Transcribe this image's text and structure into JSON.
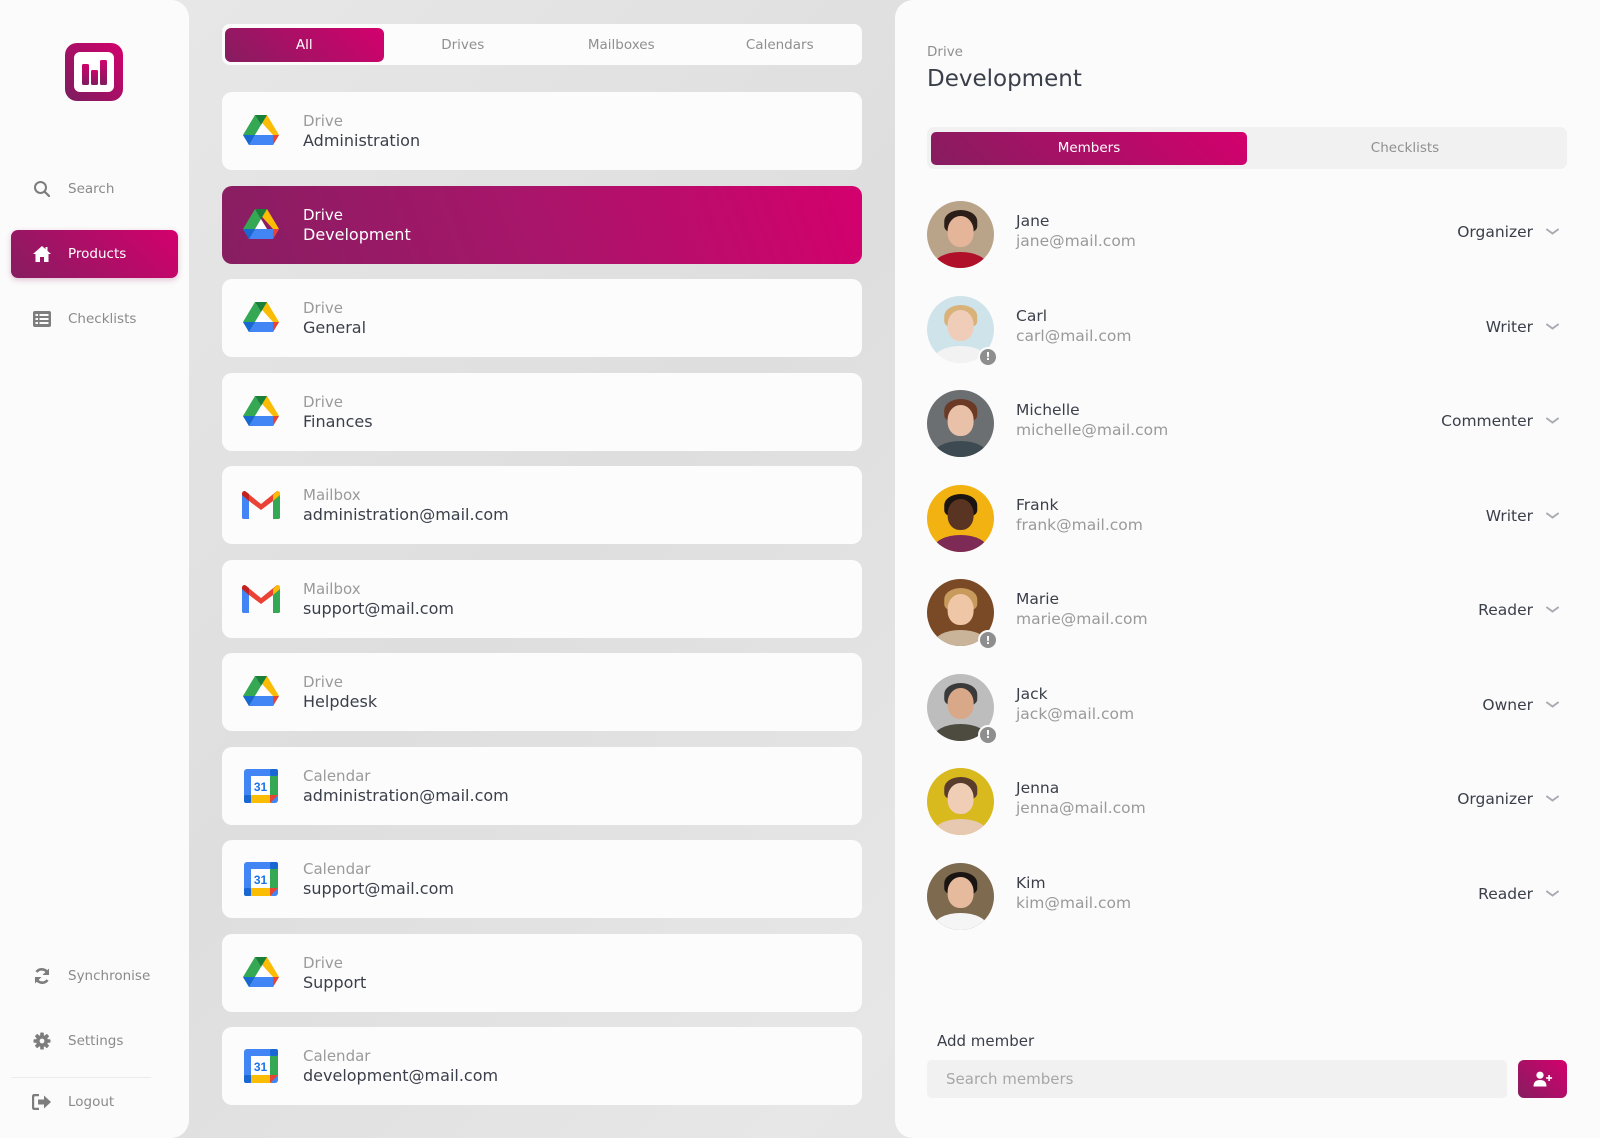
{
  "colors": {
    "accent_start": "#d4006d",
    "accent_end": "#861d60",
    "muted_text": "#8f8f8f",
    "primary_text": "#3a3f4a"
  },
  "sidebar": {
    "logo_icon": "bar-chart-logo",
    "items": [
      {
        "label": "Search",
        "icon": "search-icon",
        "active": false
      },
      {
        "label": "Products",
        "icon": "home-icon",
        "active": true
      },
      {
        "label": "Checklists",
        "icon": "list-icon",
        "active": false
      }
    ],
    "bottom_items": [
      {
        "label": "Synchronise",
        "icon": "sync-icon"
      },
      {
        "label": "Settings",
        "icon": "gear-icon"
      },
      {
        "label": "Logout",
        "icon": "logout-icon"
      }
    ]
  },
  "filter_tabs": [
    {
      "label": "All",
      "active": true
    },
    {
      "label": "Drives",
      "active": false
    },
    {
      "label": "Mailboxes",
      "active": false
    },
    {
      "label": "Calendars",
      "active": false
    }
  ],
  "resources": [
    {
      "type": "Drive",
      "name": "Administration",
      "icon": "google-drive-icon",
      "active": false
    },
    {
      "type": "Drive",
      "name": "Development",
      "icon": "google-drive-icon",
      "active": true
    },
    {
      "type": "Drive",
      "name": "General",
      "icon": "google-drive-icon",
      "active": false
    },
    {
      "type": "Drive",
      "name": "Finances",
      "icon": "google-drive-icon",
      "active": false
    },
    {
      "type": "Mailbox",
      "name": "administration@mail.com",
      "icon": "gmail-icon",
      "active": false
    },
    {
      "type": "Mailbox",
      "name": "support@mail.com",
      "icon": "gmail-icon",
      "active": false
    },
    {
      "type": "Drive",
      "name": "Helpdesk",
      "icon": "google-drive-icon",
      "active": false
    },
    {
      "type": "Calendar",
      "name": "administration@mail.com",
      "icon": "google-calendar-icon",
      "active": false
    },
    {
      "type": "Calendar",
      "name": "support@mail.com",
      "icon": "google-calendar-icon",
      "active": false
    },
    {
      "type": "Drive",
      "name": "Support",
      "icon": "google-drive-icon",
      "active": false
    },
    {
      "type": "Calendar",
      "name": "development@mail.com",
      "icon": "google-calendar-icon",
      "active": false
    }
  ],
  "calendar_icon_text": "31",
  "detail": {
    "type": "Drive",
    "title": "Development",
    "tabs": [
      {
        "label": "Members",
        "active": true
      },
      {
        "label": "Checklists",
        "active": false
      }
    ],
    "members": [
      {
        "name": "Jane",
        "email": "jane@mail.com",
        "role": "Organizer",
        "warning": false
      },
      {
        "name": "Carl",
        "email": "carl@mail.com",
        "role": "Writer",
        "warning": true
      },
      {
        "name": "Michelle",
        "email": "michelle@mail.com",
        "role": "Commenter",
        "warning": false
      },
      {
        "name": "Frank",
        "email": "frank@mail.com",
        "role": "Writer",
        "warning": false
      },
      {
        "name": "Marie",
        "email": "marie@mail.com",
        "role": "Reader",
        "warning": true
      },
      {
        "name": "Jack",
        "email": "jack@mail.com",
        "role": "Owner",
        "warning": true
      },
      {
        "name": "Jenna",
        "email": "jenna@mail.com",
        "role": "Organizer",
        "warning": false
      },
      {
        "name": "Kim",
        "email": "kim@mail.com",
        "role": "Reader",
        "warning": false
      }
    ],
    "warning_badge_text": "!",
    "add_member": {
      "label": "Add member",
      "placeholder": "Search members",
      "value": "",
      "button_icon": "add-user-icon"
    }
  }
}
